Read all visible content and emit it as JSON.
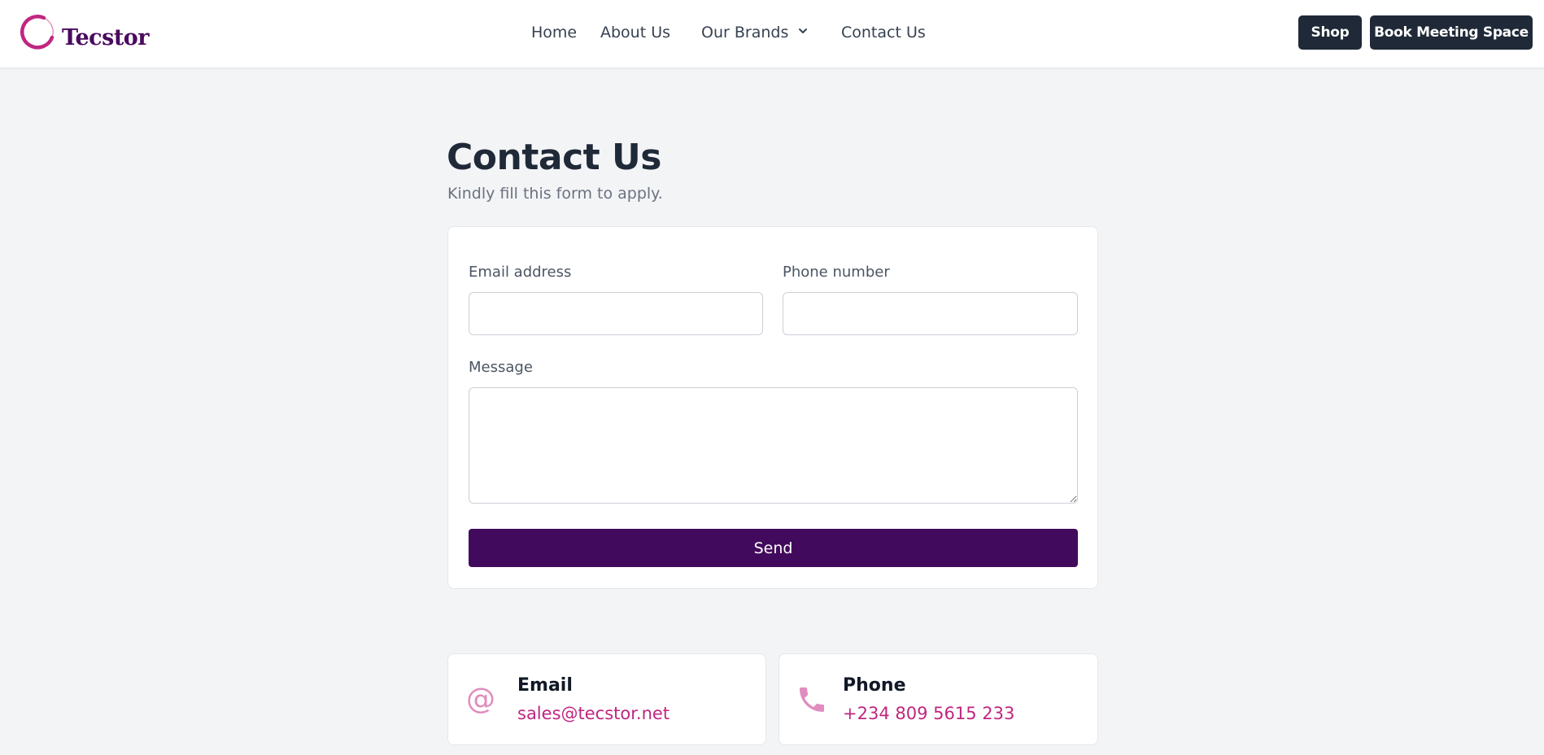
{
  "brand": {
    "name": "Tecstor",
    "primary_color": "#420a5c",
    "accent_color": "#c0267f"
  },
  "nav": {
    "home": "Home",
    "about": "About Us",
    "brands": "Our Brands",
    "contact": "Contact Us"
  },
  "header_buttons": {
    "shop": "Shop",
    "book": "Book Meeting Space"
  },
  "page": {
    "title": "Contact Us",
    "subtitle": "Kindly fill this form to apply."
  },
  "form": {
    "email_label": "Email address",
    "email_value": "",
    "phone_label": "Phone number",
    "phone_value": "",
    "message_label": "Message",
    "message_value": "",
    "send_label": "Send"
  },
  "contact_cards": {
    "email": {
      "icon": "at-icon",
      "title": "Email",
      "value": "sales@tecstor.net"
    },
    "phone": {
      "icon": "phone-icon",
      "title": "Phone",
      "value": "+234 809 5615 233"
    }
  }
}
